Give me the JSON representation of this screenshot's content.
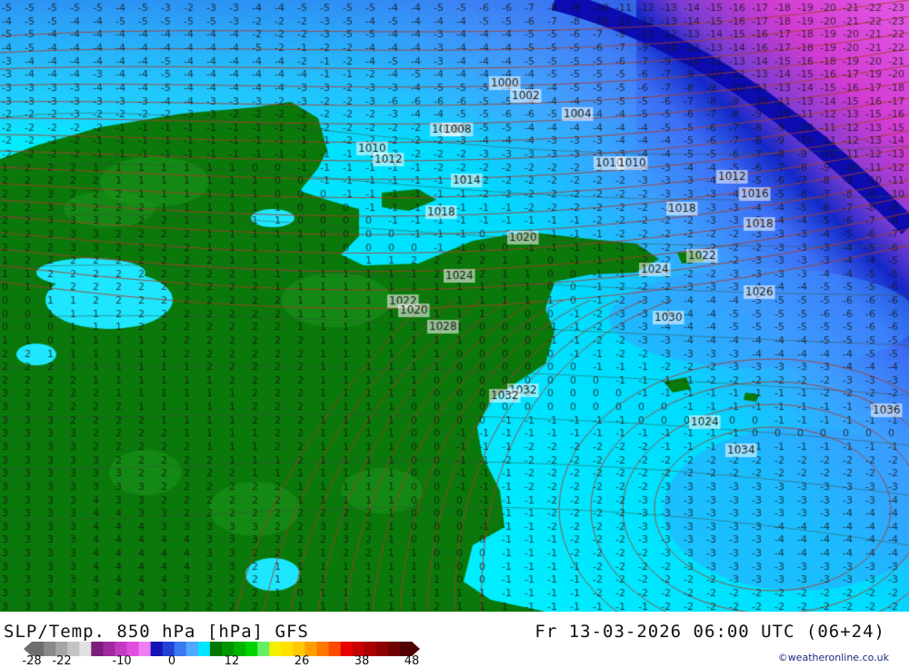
{
  "map": {
    "value_rows": [
      "-5 -5 -5 -5 -5 -4 -5 -3 -2 -3 -3 -4 -4 -5 -5 -5 -5 -4 -4 -5 -5 -6 -6 -7 -8 -9 -10 -11 -12 -13 -14 -15 -16 -17 -18 -19 -20 -21 -22 -23",
      "-4 -5 -5 -4 -4 -5 -5 -5 -5 -5 -3 -2 -2 -2 -3 -5 -4 -5 -4 -4 -4 -5 -5 -6 -7 -8 -10 -11 -12 -13 -14 -15 -16 -17 -18 -19 -20 -21 -22 -23",
      "-5 -5 -4 -4 -4 -4 -4 -4 -4 -4 -4 -2 -2 -2 -3 -5 -5 -4 -4 -3 -4 -4 -4 -5 -5 -6 -7 -9 -11 -12 -13 -14 -15 -16 -17 -18 -19 -20 -21 -22",
      "-4 -5 -4 -4 -4 -4 -4 -4 -4 -4 -4 -5 -2 -1 -2 -2 -4 -4 -4 -3 -4 -4 -4 -5 -5 -5 -6 -7 -9 -10 -12 -13 -14 -16 -17 -18 -19 -20 -21 -22",
      "-3 -4 -4 -4 -4 -4 -4 -5 -4 -4 -4 -4 -4 -2 -1 -2 -4 -5 -4 -3 -4 -4 -4 -5 -5 -5 -5 -6 -7 -9 -10 -11 -13 -14 -15 -16 -18 -19 -20 -21",
      "-3 -4 -4 -4 -3 -4 -4 -5 -4 -4 -4 -4 -4 -4 -1 -1 -2 -4 -5 -4 -4 -4 -4 -4 -5 -5 -5 -5 -6 -7 -9 -10 -12 -13 -14 -15 -16 -17 -19 -20",
      "-3 -3 -3 -3 -4 -4 -4 -5 -4 -4 -4 -4 -4 -3 -3 -2 -3 -3 -4 -5 -5 -5 -4 -4 -4 -5 -5 -5 -6 -7 -8 -9 -10 -11 -13 -14 -15 -16 -17 -18",
      "-3 -3 -3 -3 -3 -3 -3 -4 -4 -3 -3 -3 -2 -3 -2 -2 -3 -6 -6 -6 -6 -5 -5 -4 -4 -4 -5 -5 -5 -6 -7 -8 -9 -10 -11 -13 -14 -15 -16 -17",
      "-2 -2 -2 -3 -2 -2 -2 -2 -3 -3 -2 -2 -2 -2 -2 -2 -2 -3 -4 -4 -5 -5 -6 -6 -5 -4 -4 -4 -5 -5 -6 -7 -8 -9 -10 -11 -12 -13 -15 -16",
      "-2 -2 -2 -2 -2 -1 -1 -1 -1 -1 -1 -1 -1 -2 -2 -2 -2 -2 -2 -3 -4 -5 -5 -4 -4 -4 -4 -4 -4 -5 -5 -6 -7 -8 -9 -10 -11 -12 -13 -15",
      "-2 -2 -2 -2 -1 -1 -1 -1 -1 -1 -1 -1 -1 -1 -1 -2 -2 -2 -2 -2 -3 -4 -4 -4 -3 -3 -3 -4 -4 -4 -5 -6 -7 -8 -9 -10 -11 -12 -13 -14",
      "-2 -2 -2 -2 -1 -1 -1 -1 -1 -1 -1 -1 -1 -1 -1 -1 -1 -2 -2 -2 -2 -3 -3 -3 -3 -3 -3 -3 -4 -4 -5 -5 -6 -7 -8 -9 -10 -11 -12 -13",
      "1 2 2 2 1 1 1 1 1 1 1 0 0 -1 -1 -1 -1 -1 -1 -2 -2 -2 -2 -2 -2 -2 -3 -3 -3 -3 -4 -4 -5 -6 -7 -8 -9 -10 -11 -12",
      "2 2 2 2 2 1 1 1 1 1 1 1 0 0 -1 -1 -1 -1 -1 -1 -2 -2 -2 -2 -2 -2 -2 -2 -3 -3 -3 -4 -4 -5 -6 -7 -8 -9 -10 -11",
      "2 2 3 2 2 2 1 1 1 1 1 1 0 0 0 -1 -1 -1 -1 -1 -1 -2 -2 -2 -2 -2 -2 -2 -2 -3 -3 -3 -4 -4 -5 -6 -7 -8 -9 -10",
      "2 2 3 3 2 2 2 1 1 1 1 1 1 0 0 0 -1 -1 -1 -1 -1 -1 -1 -2 -2 -2 -2 -2 -2 -2 -3 -3 -3 -4 -4 -5 -6 -7 -8 -9",
      "2 2 3 3 3 2 2 2 1 1 1 1 1 0 0 0 0 -1 -1 -1 -1 -1 -1 -1 -1 -1 -2 -2 -2 -2 -2 -3 -3 -3 -4 -4 -5 -6 -7 -8",
      "2 2 3 3 3 2 2 2 2 1 1 1 1 1 0 0 0 0 -1 -1 -1 0 -1 -1 -1 -1 -1 -2 -2 -2 -2 -2 -2 -3 -3 -3 -4 -5 -6 -7",
      "2 2 2 3 3 2 2 2 2 1 1 1 1 1 1 0 0 0 0 -1 -1 0 0 -1 -1 -1 -1 -1 -2 -2 -2 -2 -2 -2 -3 -3 -3 -4 -5 -6",
      "1 2 2 2 2 2 2 2 2 2 1 1 1 1 1 1 1 1 2 2 2 2 1 1 0 -1 -1 -1 -2 -2 -2 -2 -2 -3 -3 -3 -3 -4 -4 -5",
      "1 1 2 2 2 2 2 2 2 2 2 1 1 1 1 1 1 1 1 2 2 2 1 1 0 0 -1 -1 -2 -2 -2 -2 -3 -3 -3 -3 -4 -4 -5 -5",
      "0 1 1 2 2 2 2 2 2 2 2 2 1 1 1 1 1 1 1 1 1 1 1 1 0 0 -1 -2 -2 -2 -3 -3 -3 -4 -4 -4 -5 -5 -5 -6",
      "0 0 1 1 2 2 2 2 2 2 2 2 2 1 1 1 1 1 1 1 1 1 1 1 1 0 -1 -2 -3 -3 -4 -4 -4 -5 -5 -5 -5 -6 -6 -6",
      "0 0 1 1 1 2 2 2 2 2 2 2 2 1 1 1 1 1 1 1 1 1 1 0 0 -1 -2 -3 -3 -4 -4 -4 -5 -5 -5 -5 -6 -6 -6 -6",
      "0 0 0 1 1 1 2 2 2 2 2 2 2 1 1 1 1 1 1 1 1 0 0 0 -1 -1 -2 -3 -3 -4 -4 -4 -5 -5 -5 -5 -5 -5 -6 -6",
      "1 1 0 1 1 1 1 2 2 2 2 2 2 2 1 1 1 1 1 1 1 0 0 0 -1 -1 -2 -2 -3 -3 -4 -4 -4 -4 -4 -4 -5 -5 -5 -5",
      "2 2 1 1 1 1 1 1 2 2 2 2 2 2 1 1 1 1 1 1 0 0 0 0 0 -1 -1 -2 -2 -3 -3 -3 -3 -4 -4 -4 -4 -4 -5 -5",
      "2 2 2 1 1 1 1 1 1 2 2 2 2 2 1 1 1 1 1 1 0 0 0 0 0 0 -1 -1 -1 -2 -2 -2 -3 -3 -3 -3 -3 -4 -4 -4",
      "2 2 2 2 1 1 1 1 1 1 2 2 2 2 1 1 1 1 1 0 0 0 0 0 0 0 0 -1 -1 -1 -1 -2 -2 -2 -2 -2 -2 -3 -3 -3",
      "3 2 2 2 2 1 1 1 1 1 1 2 2 2 1 1 1 1 1 0 0 0 0 0 0 0 0 0 -1 -1 -1 -1 -1 -1 -1 -1 -2 -2 -2 -2",
      "3 3 2 2 2 2 1 1 1 1 1 2 2 2 1 1 1 1 0 0 0 0 0 0 0 0 0 0 0 0 -1 -1 -1 -1 -1 -1 -1 -1 -1 -2",
      "3 3 3 2 2 2 2 1 1 1 1 2 2 2 1 1 1 1 0 0 0 0 -1 -1 -1 -1 -1 -1 0 0 0 0 0 0 -1 -1 -1 -1 -1 -1",
      "3 3 3 3 2 2 2 2 1 1 1 1 2 2 1 1 1 1 0 0 -1 -1 -1 -1 -1 -1 -1 -1 -1 -1 -1 -1 -1 0 0 0 0 0 0 0",
      "3 3 3 3 2 2 2 2 2 1 1 1 2 2 1 1 1 1 0 0 -1 -1 -1 -2 -2 -2 -2 -2 -2 -1 -1 -1 -1 -1 -1 -1 -1 -1 -1 -1",
      "3 3 3 3 3 2 2 2 2 2 1 1 1 2 1 1 1 1 0 0 -1 -1 -2 -2 -2 -2 -2 -2 -2 -2 -2 -2 -2 -2 -2 -2 -2 -2 -2 -2",
      "3 3 3 3 3 3 2 2 2 2 2 1 1 1 1 1 1 1 0 0 -1 -1 -1 -2 -2 -2 -2 -2 -2 -2 -2 -2 -2 -2 -2 -2 -2 -2 -2 -2",
      "3 3 3 3 3 3 3 2 2 2 2 2 2 1 1 1 1 1 0 0 -1 -1 -1 -2 -2 -2 -2 -2 -2 -3 -3 -3 -3 -3 -3 -3 -3 -3 -3 -3",
      "3 3 3 3 4 3 3 2 2 2 2 2 2 1 1 1 1 1 0 0 0 -1 -1 -1 -2 -2 -2 -2 -3 -3 -3 -3 -3 -3 -3 -3 -3 -3 -3 -4",
      "3 3 3 3 4 4 3 3 2 2 2 2 2 2 2 2 2 1 0 0 0 -1 -1 -1 -2 -2 -2 -2 -3 -3 -3 -3 -3 -3 -3 -3 -3 -4 -4 -4",
      "3 3 3 3 4 4 4 3 3 3 3 3 2 2 3 3 2 1 0 0 0 -1 -1 -1 -2 -2 -2 -2 -3 -3 -3 -3 -3 -3 -4 -4 -4 -4 -4 -4",
      "3 3 3 3 4 4 4 4 4 3 3 3 2 2 2 3 2 1 0 0 0 0 -1 -1 -1 -2 -2 -2 -3 -3 -3 -3 -3 -3 -4 -4 -4 -4 -4 -4",
      "3 3 3 3 4 4 4 4 4 3 3 2 2 1 1 2 2 1 1 0 0 0 -1 -1 -1 -2 -2 -2 -2 -3 -3 -3 -3 -3 -4 -4 -4 -4 -4 -4",
      "3 3 3 3 4 4 4 4 4 3 3 2 1 1 1 1 1 1 1 0 0 0 -1 -1 -1 -1 -2 -2 -2 -2 -3 -3 -3 -3 -3 -3 -3 -3 -3 -3",
      "3 3 3 3 4 4 4 4 3 3 2 2 1 1 1 1 1 1 1 1 0 0 -1 -1 -1 -1 -2 -2 -2 -2 -2 -2 -3 -3 -3 -3 -3 -3 -3 -3",
      "3 3 3 3 3 4 4 3 3 2 2 2 1 0 1 1 1 1 1 1 1 1 -1 -1 -1 -1 -2 -2 -2 -2 -2 -2 -2 -2 -2 -2 -2 -2 -2 -2",
      "3 3 3 3 3 3 3 3 2 2 2 2 1 1 1 1 1 1 1 2 1 1 1 -1 -1 -1 -1 -1 -1 -2 -2 -2 -2 -2 -2 -2 -2 -2 -2 -2"
    ],
    "isobar_labels": [
      "1000",
      "1002",
      "1004",
      "1006",
      "1008",
      "1010",
      "1012",
      "1010",
      "1010",
      "1012",
      "1014",
      "1016",
      "1018",
      "1018",
      "1018",
      "1020",
      "1022",
      "1024",
      "1024",
      "1026",
      "1022",
      "1020",
      "1028",
      "1030",
      "1032",
      "1024",
      "1034",
      "1036",
      "1032"
    ]
  },
  "footer": {
    "title_left": "SLP/Temp. 850 hPa [hPa] GFS",
    "title_right": "Fr 13-03-2026 06:00 UTC (06+24)",
    "credit": "©weatheronline.co.uk"
  },
  "legend": {
    "tick_labels": [
      "-28",
      "-22",
      "-10",
      "0",
      "12",
      "26",
      "38",
      "48"
    ],
    "tick_values": [
      -28,
      -22,
      -10,
      0,
      12,
      26,
      38,
      48
    ],
    "min": -28,
    "max": 48,
    "colors": [
      "#6e6e6e",
      "#8a8a8a",
      "#a6a6a6",
      "#c4c4c4",
      "#e0e0e0",
      "#7a1f7a",
      "#9e2b9e",
      "#c23ac2",
      "#e04fe0",
      "#f07ef0",
      "#1414b4",
      "#2040d8",
      "#3c78f0",
      "#50a8ff",
      "#00e6ff",
      "#007800",
      "#009600",
      "#00b400",
      "#00d200",
      "#64f064",
      "#f0f000",
      "#ffe100",
      "#ffc800",
      "#ffa000",
      "#ff7800",
      "#ff4b00",
      "#e60000",
      "#c80000",
      "#aa0000",
      "#8c0000",
      "#6e0000",
      "#500000"
    ]
  }
}
